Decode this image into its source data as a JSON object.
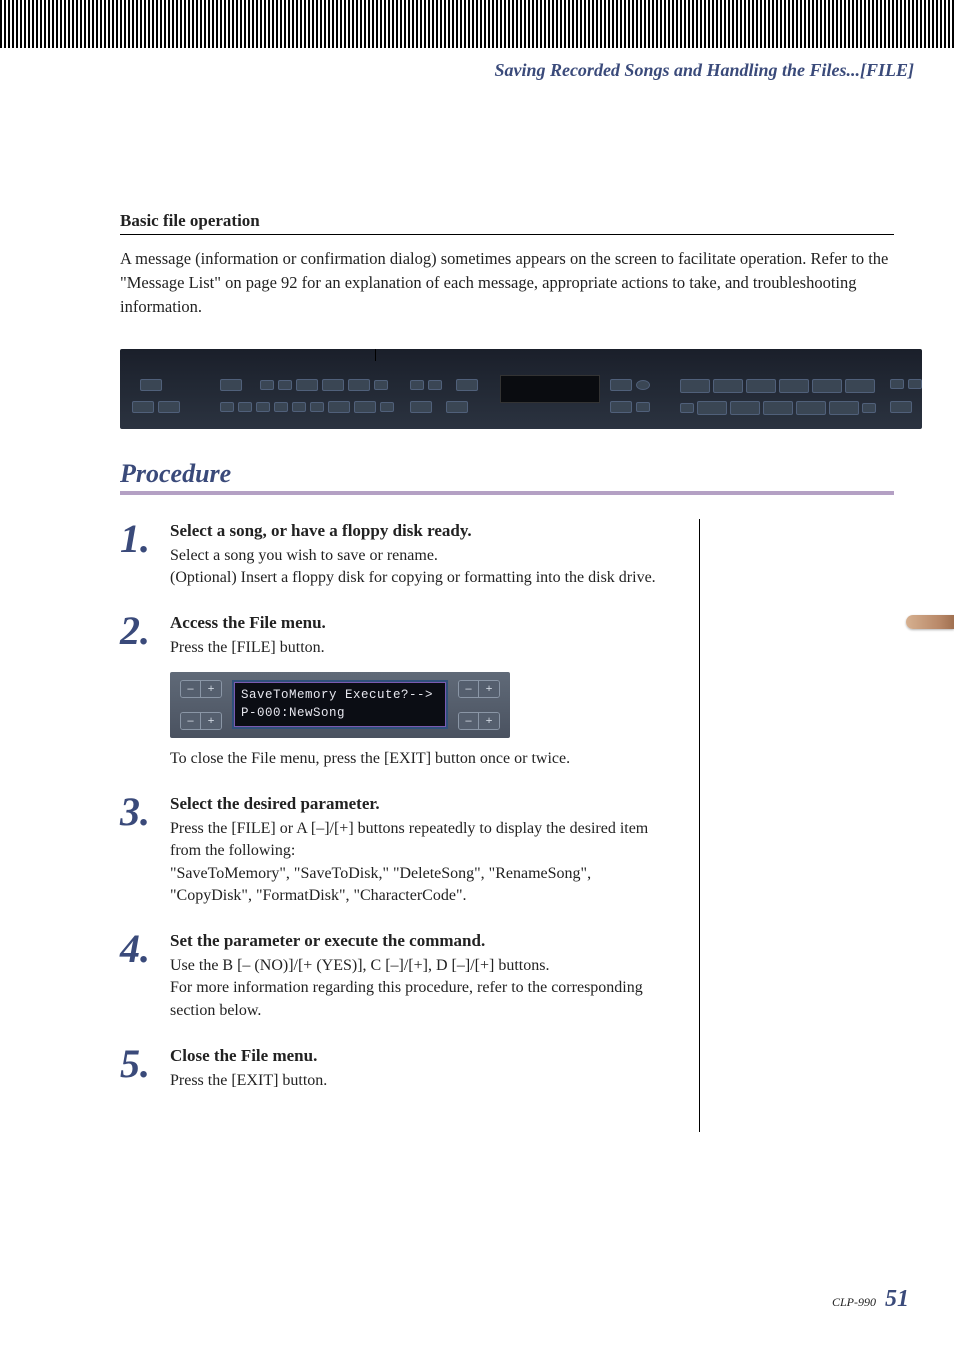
{
  "header": {
    "running_title": "Saving Recorded Songs and Handling the Files...[FILE]"
  },
  "section": {
    "heading": "Basic file operation",
    "description": "A message (information or confirmation dialog) sometimes appears on the screen to facilitate operation. Refer to the \"Message List\" on page 92 for an explanation of each message, appropriate actions to take, and troubleshooting information."
  },
  "procedure": {
    "heading": "Procedure",
    "steps": [
      {
        "num": "1.",
        "title": "Select a song, or have a floppy disk ready.",
        "body_lines": [
          "Select a song you wish to save or rename.",
          "(Optional) Insert a floppy disk for copying or formatting into the disk drive."
        ]
      },
      {
        "num": "2.",
        "title": "Access the File menu.",
        "body_lines": [
          "Press the [FILE] button."
        ],
        "lcd": {
          "line1": "SaveToMemory Execute?-->",
          "line2": "P-000:NewSong"
        },
        "after_lcd": "To close the File menu, press the [EXIT] button once or twice."
      },
      {
        "num": "3.",
        "title": "Select the desired parameter.",
        "body_lines": [
          "Press the [FILE] or A [–]/[+] buttons repeatedly to display the desired item from the following:",
          "\"SaveToMemory\", \"SaveToDisk,\" \"DeleteSong\", \"RenameSong\", \"CopyDisk\", \"FormatDisk\", \"CharacterCode\"."
        ]
      },
      {
        "num": "4.",
        "title": "Set the parameter or execute the command.",
        "body_lines": [
          "Use the B [– (NO)]/[+ (YES)], C [–]/[+], D [–]/[+] buttons.",
          "For more information regarding this procedure, refer to the corresponding section below."
        ]
      },
      {
        "num": "5.",
        "title": "Close the File menu.",
        "body_lines": [
          "Press the [EXIT] button."
        ]
      }
    ]
  },
  "lcd_buttons": {
    "minus": "–",
    "plus": "+"
  },
  "footer": {
    "model": "CLP-990",
    "page": "51"
  }
}
